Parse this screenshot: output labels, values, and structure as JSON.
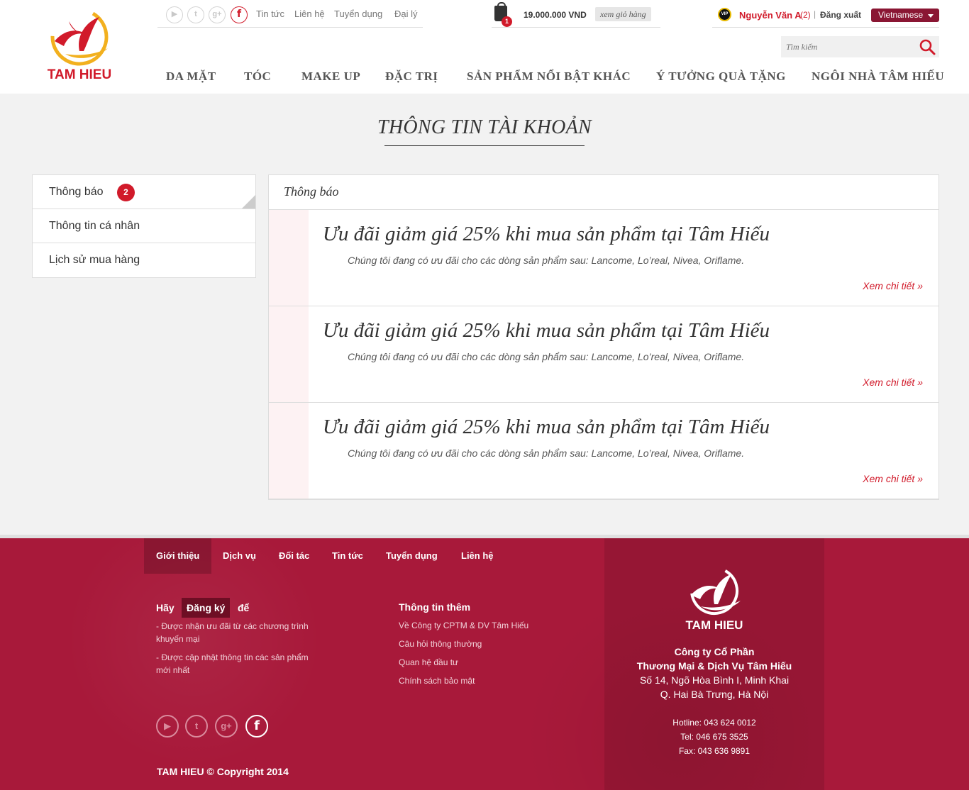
{
  "brand": {
    "logo_text": "TAM HIEU",
    "primary_color": "#d11a2a",
    "footer_color": "#a8193a"
  },
  "topbar": {
    "social": [
      {
        "icon": "youtube-icon",
        "glyph": "▶"
      },
      {
        "icon": "twitter-icon",
        "glyph": "t"
      },
      {
        "icon": "google-plus-icon",
        "glyph": "g+"
      },
      {
        "icon": "facebook-icon",
        "glyph": "f"
      }
    ],
    "links": [
      "Tin tức",
      "Liên hệ",
      "Tuyển dụng",
      "Đại lý"
    ]
  },
  "cart": {
    "count": "1",
    "total": "19.000.000 VND",
    "view_label": "xem giỏ hàng"
  },
  "user": {
    "vip_label": "VIP",
    "name": "Nguyễn Văn A",
    "count": "(2)",
    "separator": "|",
    "logout": "Đăng xuất",
    "language": "Vietnamese"
  },
  "search": {
    "placeholder": "Tìm kiếm"
  },
  "nav": [
    "DA MẶT",
    "TÓC",
    "MAKE UP",
    "ĐẶC TRỊ",
    "SẢN PHẨM NỔI BẬT KHÁC",
    "Ý TƯỞNG QUÀ TẶNG",
    "NGÔI NHÀ TÂM HIẾU"
  ],
  "page_title": "THÔNG TIN TÀI KHOẢN",
  "sidebar": {
    "items": [
      {
        "label": "Thông báo",
        "badge": "2"
      },
      {
        "label": "Thông tin cá nhân"
      },
      {
        "label": "Lịch sử mua hàng"
      }
    ]
  },
  "panel": {
    "heading": "Thông báo",
    "notices": [
      {
        "title": "Ưu đãi giảm giá 25% khi mua sản phẩm tại Tâm Hiếu",
        "desc": "Chúng tôi đang có ưu đãi cho các dòng sản phẩm sau: Lancome, Lo’real, Nivea, Oriflame.",
        "more": "Xem chi tiết »"
      },
      {
        "title": "Ưu đãi giảm giá 25% khi mua sản phẩm tại Tâm Hiếu",
        "desc": "Chúng tôi đang có ưu đãi cho các dòng sản phẩm sau: Lancome, Lo’real, Nivea, Oriflame.",
        "more": "Xem chi tiết »"
      },
      {
        "title": "Ưu đãi giảm giá 25% khi mua sản phẩm tại Tâm Hiếu",
        "desc": "Chúng tôi đang có ưu đãi cho các dòng sản phẩm sau: Lancome, Lo’real, Nivea, Oriflame.",
        "more": "Xem chi tiết »"
      }
    ]
  },
  "footer": {
    "nav": [
      "Giới thiệu",
      "Dịch vụ",
      "Đối tác",
      "Tin tức",
      "Tuyển dụng",
      "Liên hệ"
    ],
    "register": {
      "before": "Hãy",
      "button": "Đăng ký",
      "after": "để"
    },
    "bullets": [
      "- Được nhận ưu đãi từ các chương trình khuyến mại",
      "- Được cập nhật thông tin các sản phẩm mới nhất"
    ],
    "info_title": "Thông tin thêm",
    "info_links": [
      "Về Công ty CPTM & DV Tâm Hiếu",
      "Câu hỏi thông thường",
      "Quan hệ đầu tư",
      "Chính sách bảo mật"
    ],
    "social": [
      {
        "icon": "youtube-icon",
        "glyph": "▶"
      },
      {
        "icon": "twitter-icon",
        "glyph": "t"
      },
      {
        "icon": "google-plus-icon",
        "glyph": "g+"
      },
      {
        "icon": "facebook-icon",
        "glyph": "f"
      }
    ],
    "copyright": "TAM HIEU © Copyright 2014",
    "logo_text": "TAM HIEU",
    "company": [
      "Công ty Cổ Phần",
      "Thương Mại & Dịch Vụ Tâm Hiếu",
      "Số 14, Ngõ Hòa Bình I, Minh Khai",
      "Q. Hai Bà Trưng, Hà Nội"
    ],
    "contacts": [
      "Hotline: 043 624 0012",
      "Tel: 046 675 3525",
      "Fax: 043 636 9891"
    ]
  }
}
